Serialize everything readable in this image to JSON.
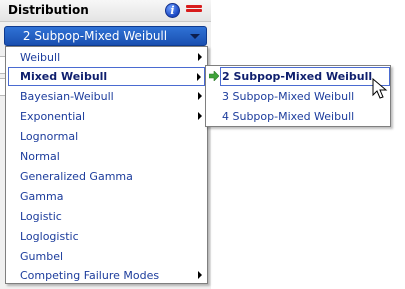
{
  "panel": {
    "title": "Distribution",
    "info_icon": "info-icon",
    "menu_icon": "menu-icon",
    "accent_color": "#1a4fb0",
    "close_color": "#d81b1b"
  },
  "combo": {
    "value": "2 Subpop-Mixed Weibull"
  },
  "main_menu": {
    "items": [
      {
        "label": "Weibull",
        "has_submenu": true
      },
      {
        "label": "Mixed Weibull",
        "has_submenu": true,
        "active": true
      },
      {
        "label": "Bayesian-Weibull",
        "has_submenu": true
      },
      {
        "label": "Exponential",
        "has_submenu": true
      },
      {
        "label": "Lognormal",
        "has_submenu": false
      },
      {
        "label": "Normal",
        "has_submenu": false
      },
      {
        "label": "Generalized Gamma",
        "has_submenu": false
      },
      {
        "label": "Gamma",
        "has_submenu": false
      },
      {
        "label": "Logistic",
        "has_submenu": false
      },
      {
        "label": "Loglogistic",
        "has_submenu": false
      },
      {
        "label": "Gumbel",
        "has_submenu": false
      },
      {
        "label": "Competing Failure Modes",
        "has_submenu": true
      }
    ]
  },
  "sub_menu": {
    "items": [
      {
        "label": "2 Subpop-Mixed Weibull",
        "active": true
      },
      {
        "label": "3 Subpop-Mixed Weibull"
      },
      {
        "label": "4 Subpop-Mixed Weibull"
      }
    ]
  }
}
